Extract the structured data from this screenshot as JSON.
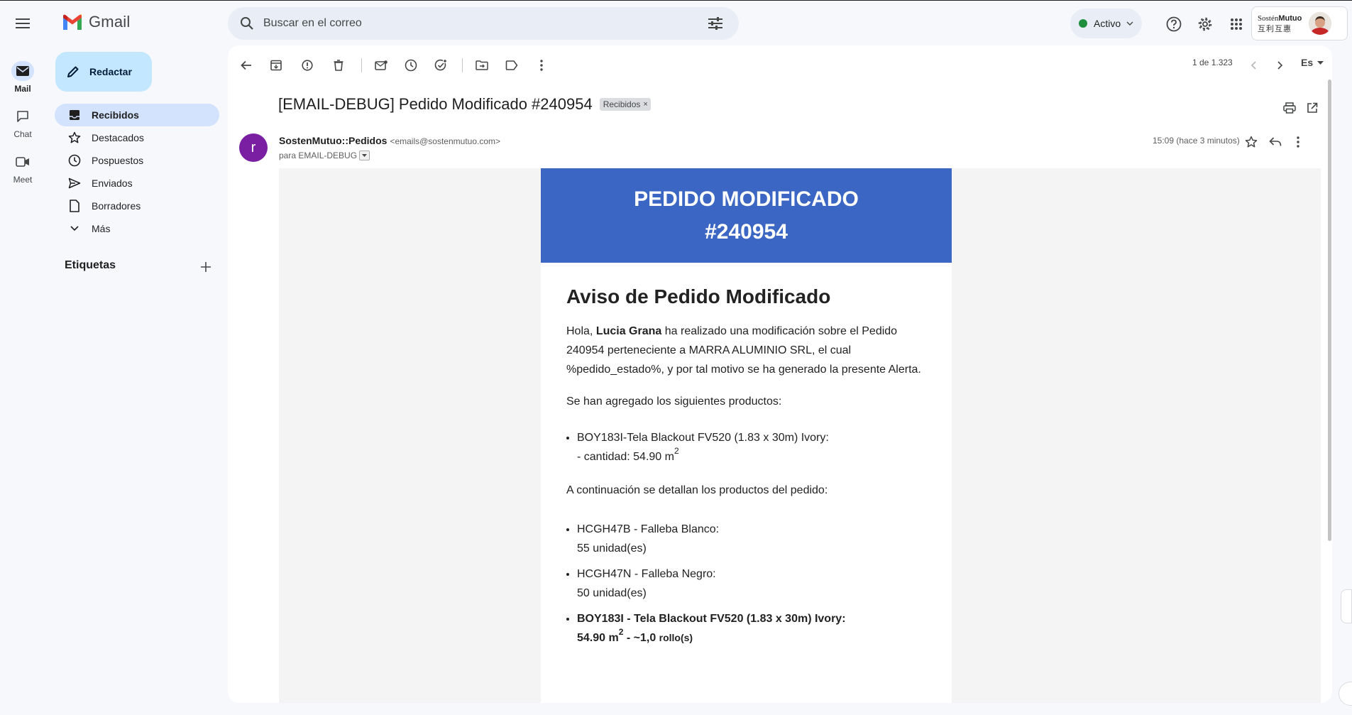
{
  "rail": {
    "items": [
      {
        "label": "Mail",
        "icon": "mail-icon"
      },
      {
        "label": "Chat",
        "icon": "chat-icon"
      },
      {
        "label": "Meet",
        "icon": "video-icon"
      }
    ]
  },
  "app": {
    "name": "Gmail"
  },
  "search": {
    "placeholder": "Buscar en el correo"
  },
  "status": {
    "label": "Activo",
    "color": "#1e8e3e"
  },
  "account": {
    "brand_line1_a": "Sostén",
    "brand_line1_b": "Mutuo",
    "brand_line2": "互利互惠"
  },
  "compose": {
    "label": "Redactar"
  },
  "nav": {
    "items": [
      {
        "label": "Recibidos",
        "icon": "inbox-icon",
        "active": true
      },
      {
        "label": "Destacados",
        "icon": "star-icon"
      },
      {
        "label": "Pospuestos",
        "icon": "clock-icon"
      },
      {
        "label": "Enviados",
        "icon": "send-icon"
      },
      {
        "label": "Borradores",
        "icon": "draft-icon"
      },
      {
        "label": "Más",
        "icon": "chevron-down-icon"
      }
    ],
    "labels_title": "Etiquetas"
  },
  "toolbar": {
    "pager": "1 de 1.323",
    "lang": "Es"
  },
  "message": {
    "subject": "[EMAIL-DEBUG] Pedido Modificado #240954",
    "label_chip": "Recibidos",
    "sender_name": "SostenMutuo::Pedidos",
    "sender_email": "<emails@sostenmutuo.com>",
    "sender_initial": "r",
    "avatar_color": "#7b1fa2",
    "recipient": "para EMAIL-DEBUG",
    "time": "15:09 (hace 3 minutos)"
  },
  "email": {
    "banner_color": "#3c66c3",
    "banner_line1": "PEDIDO MODIFICADO",
    "banner_line2": "#240954",
    "heading": "Aviso de Pedido Modificado",
    "greeting": "Hola,",
    "user_name": "Lucia Grana",
    "intro_rest": "ha realizado una modificación sobre el Pedido 240954 perteneciente a MARRA ALUMINIO SRL, el cual %pedido_estado%, y por tal motivo se ha generado la presente Alerta.",
    "added_title": "Se han agregado los siguientes productos:",
    "added_items": [
      {
        "line1": "BOY183I-Tela Blackout FV520 (1.83 x 30m) Ivory:",
        "line2": "- cantidad: 54.90 m",
        "sup": "2"
      }
    ],
    "detail_title": "A continuación se detallan los productos del pedido:",
    "order_items": [
      {
        "line1": "HCGH47B - Falleba Blanco:",
        "line2": "55 unidad(es)"
      },
      {
        "line1": "HCGH47N - Falleba Negro:",
        "line2": "50 unidad(es)"
      }
    ],
    "bold_item": {
      "line1": "BOY183I - Tela Blackout FV520 (1.83 x 30m) Ivory:",
      "line2_a": "54.90 m",
      "sup": "2",
      "line2_b": " - ~1,0 ",
      "line2_c": "rollo(s)"
    }
  }
}
